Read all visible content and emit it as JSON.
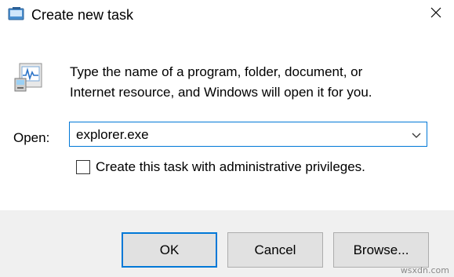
{
  "window": {
    "title": "Create new task",
    "title_icon": "task-manager-icon",
    "close_icon": "close-icon"
  },
  "body": {
    "app_icon": "run-app-icon",
    "description_line1": "Type the name of a program, folder, document, or",
    "description_line2": "Internet resource, and Windows will open it for you.",
    "open_label": "Open:",
    "open_value": "explorer.exe",
    "dropdown_icon": "chevron-down-icon",
    "admin_checkbox_label": "Create this task with administrative privileges.",
    "admin_checkbox_checked": false
  },
  "buttons": {
    "ok": "OK",
    "cancel": "Cancel",
    "browse": "Browse..."
  },
  "colors": {
    "accent": "#0078d7",
    "footer_bg": "#f0f0f0",
    "button_bg": "#e1e1e1"
  },
  "watermark": "wsxdn.com"
}
